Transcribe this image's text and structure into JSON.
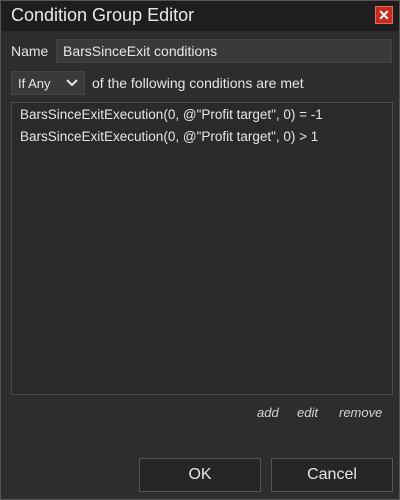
{
  "window": {
    "title": "Condition Group Editor",
    "close_glyph": "✕",
    "close_color": "#c42b1c"
  },
  "name": {
    "label": "Name",
    "value": "BarsSinceExit conditions"
  },
  "match": {
    "selected": "If Any",
    "suffix_text": "of the following conditions are met"
  },
  "conditions": [
    "BarsSinceExitExecution(0, @\"Profit target\", 0) = -1",
    "BarsSinceExitExecution(0, @\"Profit target\", 0) > 1"
  ],
  "actions": {
    "add": "add",
    "edit": "edit",
    "remove": "remove"
  },
  "buttons": {
    "ok": "OK",
    "cancel": "Cancel"
  },
  "icons": {
    "close": "close-icon",
    "dropdown": "chevron-down-icon"
  }
}
